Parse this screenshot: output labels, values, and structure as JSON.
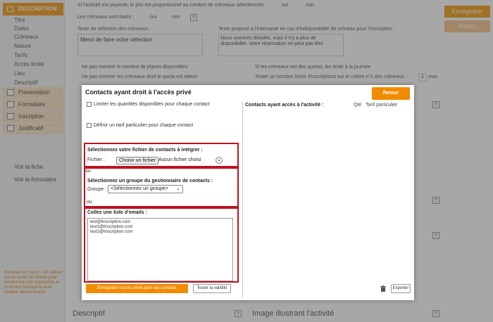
{
  "sidebar": {
    "header": "DESCRIPTION",
    "subitems": [
      "Titre",
      "Dates",
      "Créneaux",
      "Nature",
      "Tarifs",
      "Accès limité",
      "Lieu",
      "Descriptif"
    ],
    "sections": [
      "Présentation",
      "Formulaire",
      "Inscription",
      "Justificatif"
    ],
    "links": [
      "Voir la fiche",
      "Voir le formulaire"
    ],
    "note": "Evolution en cours : cet éditeur est en cours de refonte pour moderniser son ergonomie et le rendre homogène avec l'édition administration"
  },
  "header_actions": {
    "save": "Enregistrer",
    "back": "Retour"
  },
  "background": {
    "line1": "Si l'activité est payante, le prix est proportionnel au nombre de créneaux sélectionnés :",
    "line1_opt1": "oui",
    "line1_opt2": "non",
    "line2": "Les créneaux sont datés :",
    "line2_opt1": "oui",
    "line2_opt2": "non",
    "sel_label": "Texte de sélection des créneaux :",
    "sel_value": "Merci de faire votre sélection",
    "unavail_label": "Texte proposé à l'internaute en cas d'indisponibilité de créneau pour l'inscription :",
    "unavail_value": "Nous sommes désolés, mais il n'y a plus de disponibilité. Votre réservation ne peut pas être",
    "chk1": "Ne pas montrer le nombre de places disponibles",
    "chk2": "Ne pas montrer les créneaux dont le quota est atteint",
    "chk3": "Si les créneaux ont des quotas, les teste à la journée",
    "chk4": "Tester un nombre limite d'inscriptions sur le critère n°1 des créneaux :",
    "chk4_value": "1",
    "chk4_unit": "max",
    "bottom_left": "Descriptif",
    "bottom_right": "Image illustrant l'activité"
  },
  "modal": {
    "title": "Contacts ayant droit à l'accès privé",
    "close": "Retour",
    "limit_qty": "Limiter les quantités disponibles pour chaque contact",
    "define_rate": "Définir un tarif particulier pour chaque contact",
    "file_section": {
      "title": "Sélectionnez votre fichier de contacts à intégrer :",
      "label": "Fichier :",
      "button": "Choisir un fichier",
      "status": "Aucun fichier choisi"
    },
    "or1": "ou",
    "group_section": {
      "title": "Sélectionnez un groupe du gestionnaire de contacts :",
      "label": "Groupe :",
      "value": "<Sélectionnez un groupe>"
    },
    "or2": "ou",
    "email_section": {
      "title": "Collez une liste d'emails :",
      "emails": [
        "test@linscription.com",
        "test1@linscription.com",
        "test2@linscription.com"
      ]
    },
    "save_button": "Enregistrer l'accès privé pour ces contacts",
    "test_button": "Tester la validité",
    "right_title": "Contacts ayant accès à l'activité :",
    "col_qty": "Qté",
    "col_rate": "Tarif particulier",
    "export_button": "Exporter"
  },
  "colors": {
    "accent": "#f08c00",
    "highlight": "#c0121c"
  }
}
